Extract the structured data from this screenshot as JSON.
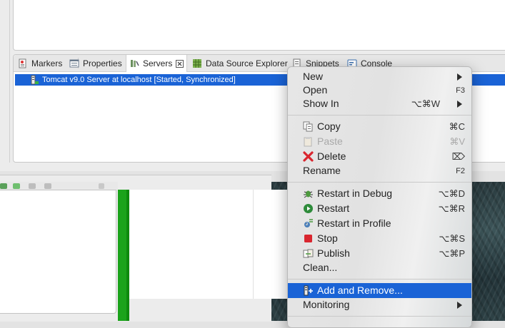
{
  "views": {
    "tabs": [
      {
        "label": "Markers",
        "icon": "markers-icon"
      },
      {
        "label": "Properties",
        "icon": "properties-icon"
      },
      {
        "label": "Servers",
        "icon": "servers-icon",
        "active": true
      },
      {
        "label": "Data Source Explorer",
        "icon": "data-source-icon"
      },
      {
        "label": "Snippets",
        "icon": "snippets-icon"
      },
      {
        "label": "Console",
        "icon": "console-icon"
      }
    ],
    "server_row": {
      "label": "Tomcat v9.0 Server at localhost  [Started, Synchronized]",
      "icon": "tomcat-server-icon"
    }
  },
  "context_menu": {
    "new": {
      "label": "New"
    },
    "open": {
      "label": "Open",
      "shortcut": "F3"
    },
    "show_in": {
      "label": "Show In",
      "shortcut": "⌥⌘W"
    },
    "copy": {
      "label": "Copy",
      "shortcut": "⌘C",
      "icon": "copy-icon"
    },
    "paste": {
      "label": "Paste",
      "shortcut": "⌘V",
      "icon": "paste-icon"
    },
    "delete": {
      "label": "Delete",
      "shortcut": "⌦",
      "icon": "delete-icon"
    },
    "rename": {
      "label": "Rename",
      "shortcut": "F2"
    },
    "restart_debug": {
      "label": "Restart in Debug",
      "shortcut": "⌥⌘D",
      "icon": "debug-icon"
    },
    "restart": {
      "label": "Restart",
      "shortcut": "⌥⌘R",
      "icon": "restart-icon"
    },
    "restart_profile": {
      "label": "Restart in Profile",
      "shortcut": "",
      "icon": "profile-icon"
    },
    "stop": {
      "label": "Stop",
      "shortcut": "⌥⌘S",
      "icon": "stop-icon"
    },
    "publish": {
      "label": "Publish",
      "shortcut": "⌥⌘P",
      "icon": "publish-icon"
    },
    "clean": {
      "label": "Clean..."
    },
    "add_remove": {
      "label": "Add and Remove...",
      "icon": "add-remove-icon"
    },
    "monitoring": {
      "label": "Monitoring"
    }
  },
  "colors": {
    "selection": "#1a63d6",
    "stop_red": "#d9262f",
    "restart_green": "#2e8b3a",
    "green_bar": "#1ba31b"
  }
}
